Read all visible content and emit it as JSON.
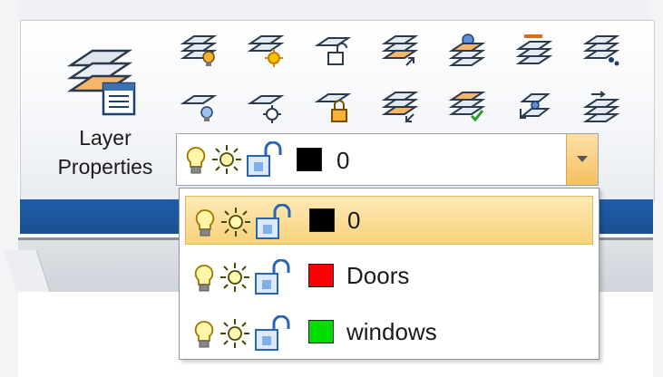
{
  "ribbon": {
    "big_button_label_line1": "Layer",
    "big_button_label_line2": "Properties"
  },
  "layer_combo": {
    "current_layer": "0",
    "current_color": "#000000"
  },
  "dropdown": {
    "items": [
      {
        "name": "0",
        "color": "#000000",
        "selected": true
      },
      {
        "name": "Doors",
        "color": "#ff0000",
        "selected": false
      },
      {
        "name": "windows",
        "color": "#00dd00",
        "selected": false
      }
    ]
  },
  "icons": {
    "tools_row1": [
      "layer-off-icon",
      "layer-freeze-icon",
      "layer-lock-icon",
      "layer-match-icon",
      "layer-isolate-icon",
      "layer-previous-icon",
      "layer-walk-icon"
    ],
    "tools_row2": [
      "layer-on-icon",
      "layer-thaw-icon",
      "layer-unlock-icon",
      "layer-change-icon",
      "layer-merge-icon",
      "layer-translate-icon",
      "layer-state-icon"
    ],
    "state_icons": [
      "bulb-icon",
      "sun-icon",
      "unlock-icon"
    ]
  },
  "colors": {
    "ribbon_panel_bar": "#1f5ea8",
    "selection": "#f8d27a"
  }
}
